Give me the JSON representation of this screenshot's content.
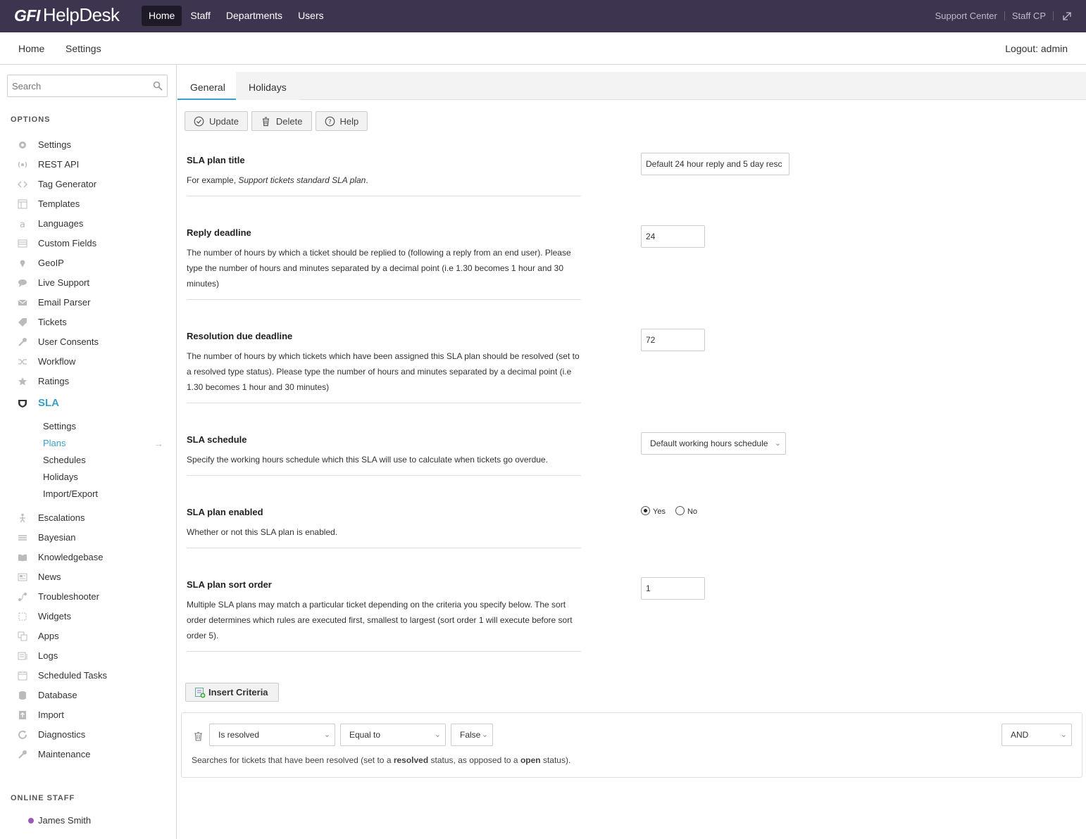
{
  "app": {
    "brand_prefix": "GFI",
    "brand_name": "HelpDesk"
  },
  "topnav": {
    "items": [
      "Home",
      "Staff",
      "Departments",
      "Users"
    ],
    "active": "Home"
  },
  "topright": {
    "support_center": "Support Center",
    "staff_cp": "Staff CP"
  },
  "subnav": {
    "home": "Home",
    "settings": "Settings",
    "logout": "Logout: admin"
  },
  "sidebar": {
    "search_placeholder": "Search",
    "options_title": "OPTIONS",
    "items": [
      {
        "label": "Settings",
        "icon": "gear-icon"
      },
      {
        "label": "REST API",
        "icon": "broadcast-icon"
      },
      {
        "label": "Tag Generator",
        "icon": "code-icon"
      },
      {
        "label": "Templates",
        "icon": "template-icon"
      },
      {
        "label": "Languages",
        "icon": "language-icon"
      },
      {
        "label": "Custom Fields",
        "icon": "list-icon"
      },
      {
        "label": "GeoIP",
        "icon": "map-pin-icon"
      },
      {
        "label": "Live Support",
        "icon": "chat-icon"
      },
      {
        "label": "Email Parser",
        "icon": "envelope-icon"
      },
      {
        "label": "Tickets",
        "icon": "ticket-icon"
      },
      {
        "label": "User Consents",
        "icon": "wrench-icon"
      },
      {
        "label": "Workflow",
        "icon": "shuffle-icon"
      },
      {
        "label": "Ratings",
        "icon": "star-icon"
      }
    ],
    "sla": {
      "label": "SLA",
      "icon": "shield-icon"
    },
    "sla_sub": [
      "Settings",
      "Plans",
      "Schedules",
      "Holidays",
      "Import/Export"
    ],
    "sla_active": "Plans",
    "items2": [
      {
        "label": "Escalations",
        "icon": "escalation-icon"
      },
      {
        "label": "Bayesian",
        "icon": "layers-icon"
      },
      {
        "label": "Knowledgebase",
        "icon": "book-icon"
      },
      {
        "label": "News",
        "icon": "newspaper-icon"
      },
      {
        "label": "Troubleshooter",
        "icon": "route-icon"
      },
      {
        "label": "Widgets",
        "icon": "widget-icon"
      },
      {
        "label": "Apps",
        "icon": "apps-icon"
      },
      {
        "label": "Logs",
        "icon": "logs-icon"
      },
      {
        "label": "Scheduled Tasks",
        "icon": "calendar-icon"
      },
      {
        "label": "Database",
        "icon": "database-icon"
      },
      {
        "label": "Import",
        "icon": "import-icon"
      },
      {
        "label": "Diagnostics",
        "icon": "refresh-icon"
      },
      {
        "label": "Maintenance",
        "icon": "tool-icon"
      }
    ],
    "online_title": "ONLINE STAFF",
    "online_staff": "James Smith",
    "online_color": "#9b59b6"
  },
  "tabs": {
    "general": "General",
    "holidays": "Holidays"
  },
  "toolbar": {
    "update": "Update",
    "delete": "Delete",
    "help": "Help"
  },
  "form": {
    "title": {
      "label": "SLA plan title",
      "desc_prefix": "For example, ",
      "desc_example": "Support tickets standard SLA plan",
      "desc_suffix": ".",
      "value": "Default 24 hour reply and 5 day resc"
    },
    "reply": {
      "label": "Reply deadline",
      "desc": "The number of hours by which a ticket should be replied to (following a reply from an end user). Please type the number of hours and minutes separated by a decimal point (i.e 1.30 becomes 1 hour and 30 minutes)",
      "value": "24"
    },
    "resolution": {
      "label": "Resolution due deadline",
      "desc": "The number of hours by which tickets which have been assigned this SLA plan should be resolved (set to a resolved type status). Please type the number of hours and minutes separated by a decimal point (i.e 1.30 becomes 1 hour and 30 minutes)",
      "value": "72"
    },
    "schedule": {
      "label": "SLA schedule",
      "desc": "Specify the working hours schedule which this SLA will use to calculate when tickets go overdue.",
      "value": "Default working hours schedule"
    },
    "enabled": {
      "label": "SLA plan enabled",
      "desc": "Whether or not this SLA plan is enabled.",
      "yes": "Yes",
      "no": "No",
      "selected": "Yes"
    },
    "sort": {
      "label": "SLA plan sort order",
      "desc": "Multiple SLA plans may match a particular ticket depending on the criteria you specify below. The sort order determines which rules are executed first, smallest to largest (sort order 1 will execute before sort order 5).",
      "value": "1"
    }
  },
  "criteria": {
    "insert_label": "Insert Criteria",
    "field": "Is resolved",
    "operator": "Equal to",
    "value": "False",
    "join": "AND",
    "note_prefix": "Searches for tickets that have been resolved (set to a ",
    "note_b1": "resolved",
    "note_mid": " status, as opposed to a ",
    "note_b2": "open",
    "note_suffix": " status)."
  },
  "colors": {
    "topbar": "#3d3450",
    "accent": "#3a9fc7",
    "active_nav": "#1e1a28"
  }
}
